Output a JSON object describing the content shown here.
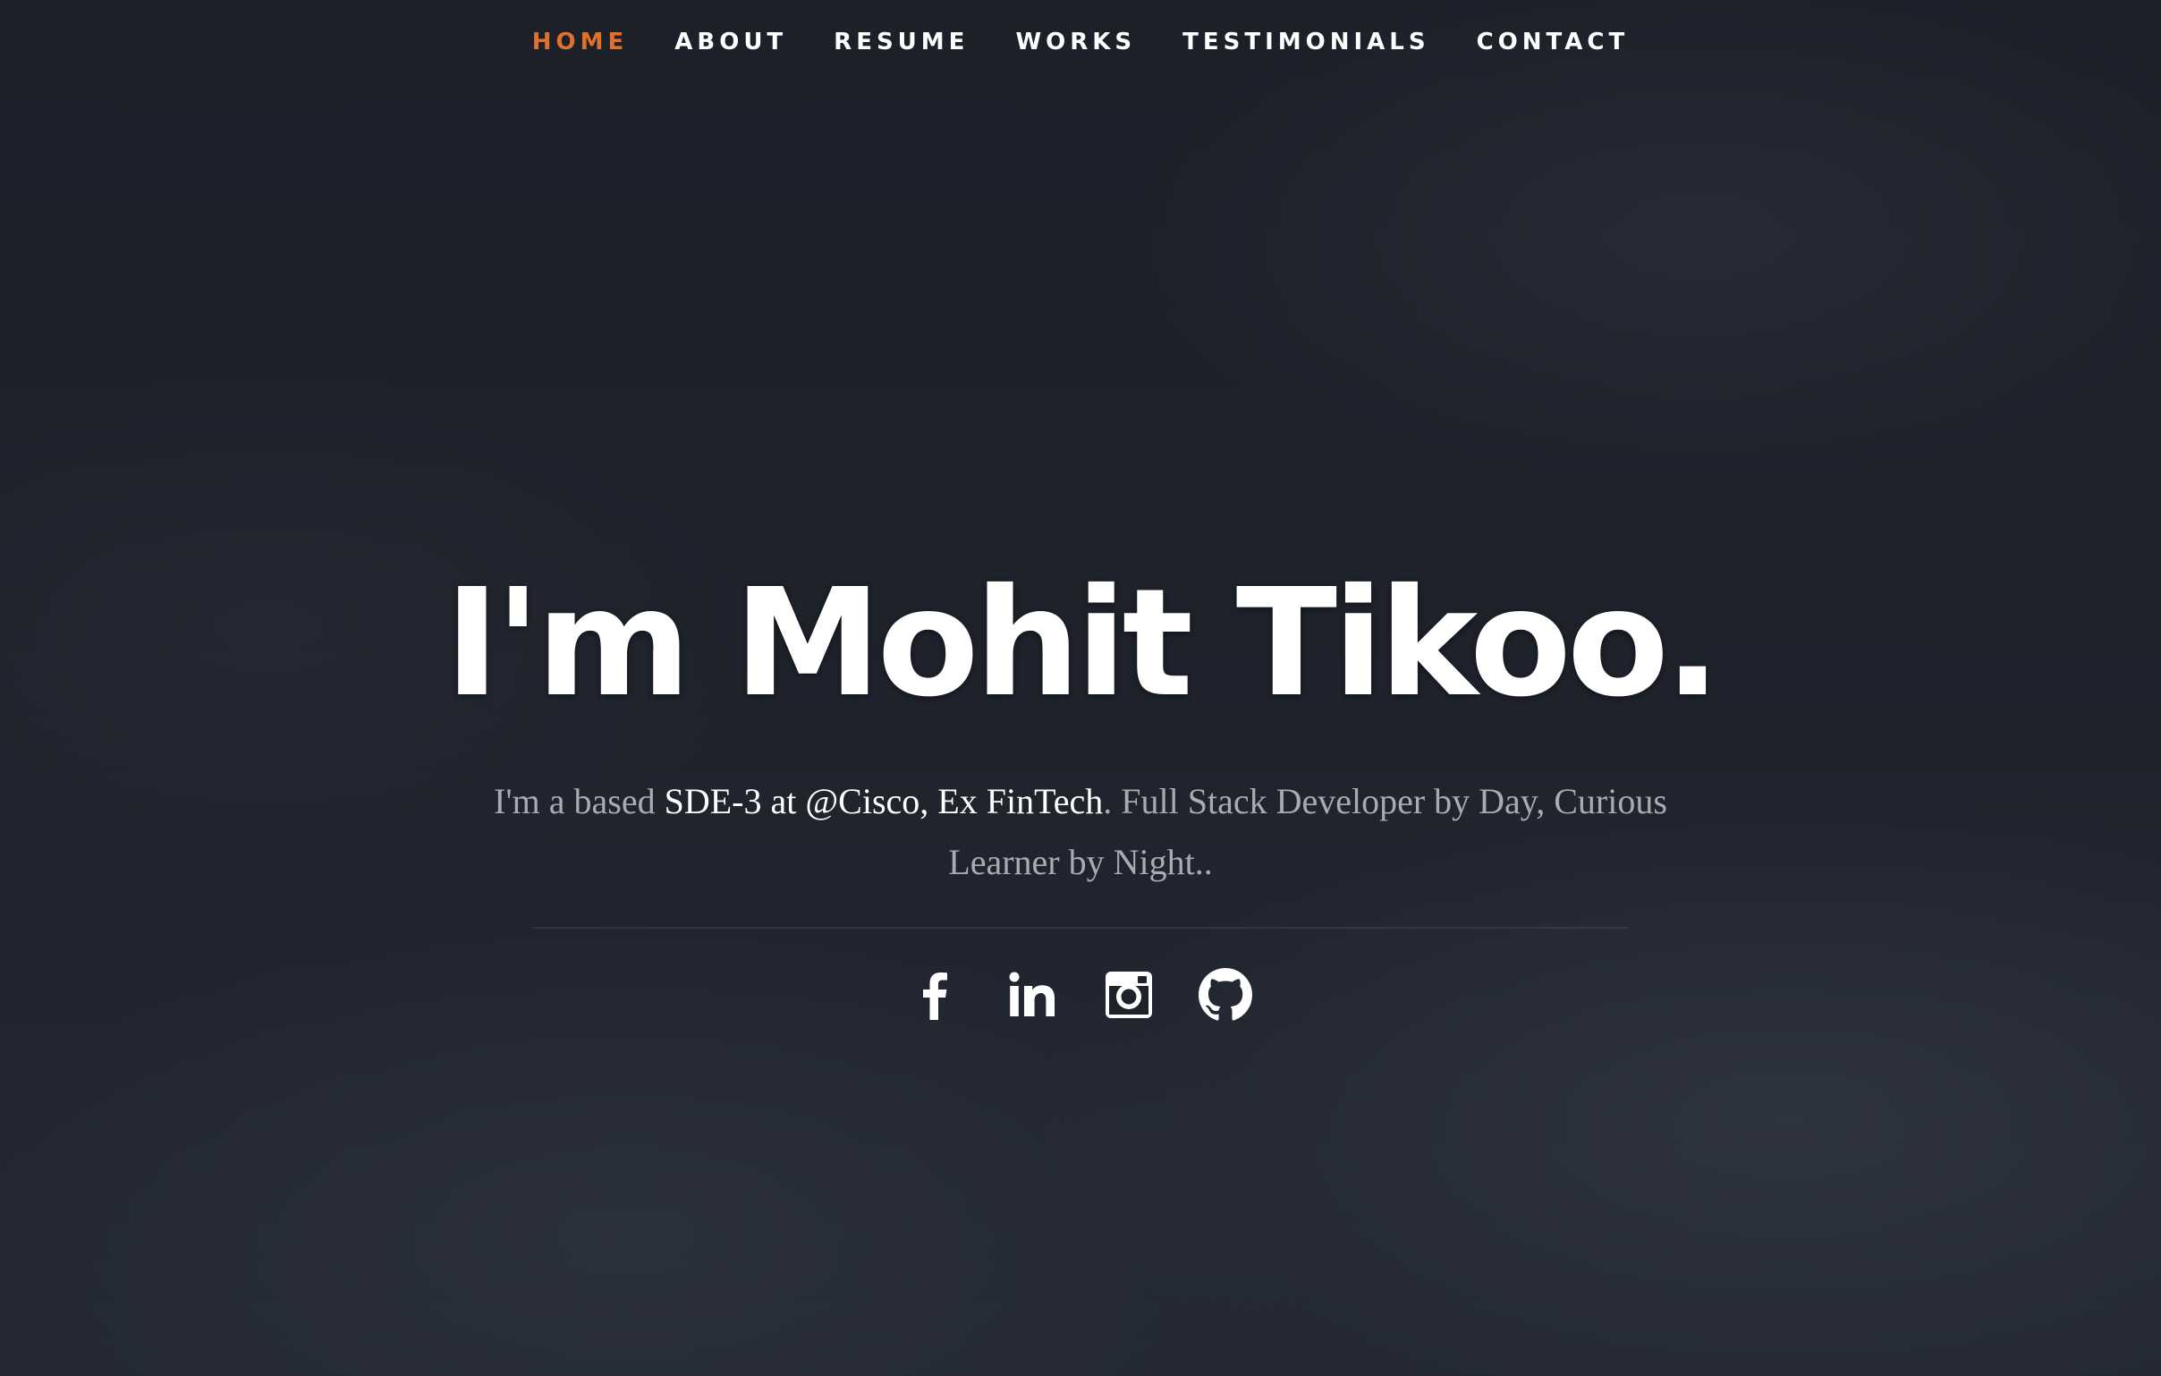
{
  "nav": {
    "items": [
      {
        "label": "HOME",
        "active": true
      },
      {
        "label": "ABOUT",
        "active": false
      },
      {
        "label": "RESUME",
        "active": false
      },
      {
        "label": "WORKS",
        "active": false
      },
      {
        "label": "TESTIMONIALS",
        "active": false
      },
      {
        "label": "CONTACT",
        "active": false
      }
    ],
    "active_color": "#e0702c",
    "text_color": "#ffffff"
  },
  "hero": {
    "headline": "I'm Mohit Tikoo.",
    "intro_prefix": "I'm a based ",
    "intro_highlight": "SDE-3 at @Cisco, Ex FinTech",
    "intro_suffix": ". Full Stack Developer by Day, Curious Learner by Night.."
  },
  "social": [
    {
      "icon": "facebook-icon"
    },
    {
      "icon": "linkedin-icon"
    },
    {
      "icon": "instagram-icon"
    },
    {
      "icon": "github-icon"
    }
  ],
  "colors": {
    "background": "#1e222b",
    "intro_text": "#a8abb1",
    "accent": "#e0702c"
  }
}
